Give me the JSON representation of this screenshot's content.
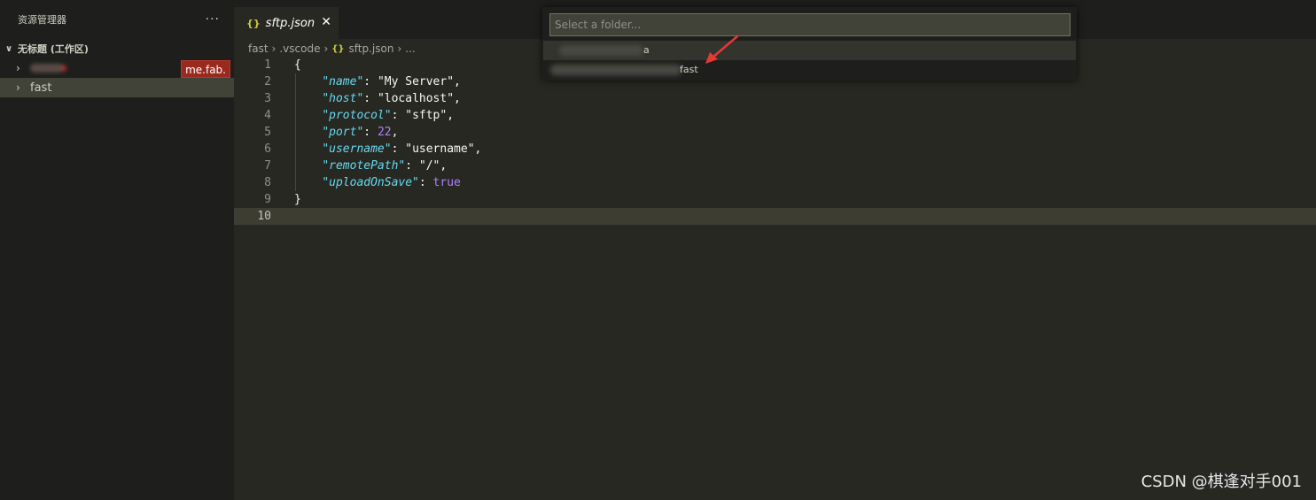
{
  "sidebar": {
    "title": "资源管理器",
    "more_label": "···",
    "section_title": "无标题 (工作区)",
    "items": [
      {
        "label": "",
        "badge": "me.fab."
      },
      {
        "label": "fast"
      }
    ]
  },
  "tab": {
    "icon": "{}",
    "label": "sftp.json",
    "close": "✕"
  },
  "breadcrumb": {
    "parts": [
      "fast",
      ".vscode",
      "sftp.json",
      "..."
    ],
    "icon": "{}"
  },
  "editor": {
    "line_numbers": [
      "1",
      "2",
      "3",
      "4",
      "5",
      "6",
      "7",
      "8",
      "9",
      "10"
    ],
    "current_line": 10
  },
  "quickpick": {
    "placeholder": "Select a folder...",
    "items": [
      {
        "suffix": "a"
      },
      {
        "suffix": "fast"
      }
    ]
  },
  "colors": {
    "background": "#272822",
    "sidebar": "#1e1f1c",
    "keyword": "#66d9ef",
    "number": "#ae81ff",
    "arrow": "#e53935"
  },
  "watermark": "CSDN @棋逢对手001"
}
